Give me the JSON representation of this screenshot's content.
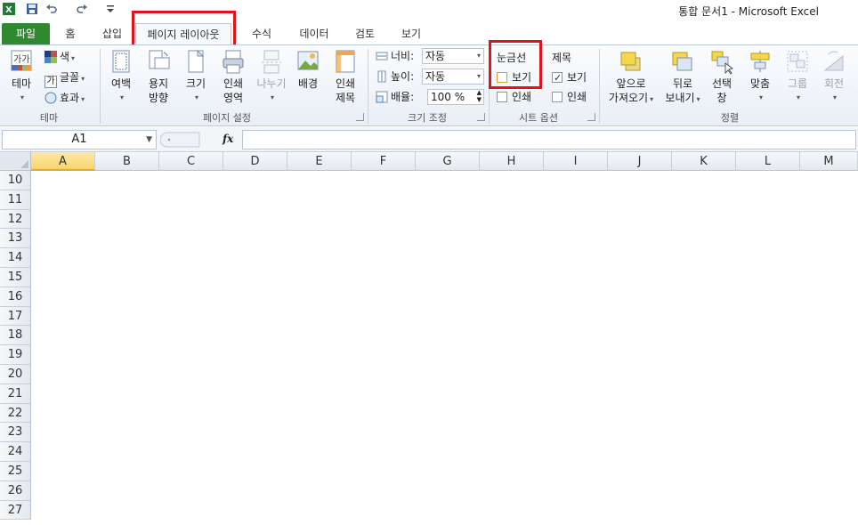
{
  "window": {
    "title": "통합 문서1  -  Microsoft Excel"
  },
  "tabs": [
    {
      "id": "file",
      "label": "파일"
    },
    {
      "id": "home",
      "label": "홈"
    },
    {
      "id": "insert",
      "label": "삽입"
    },
    {
      "id": "page_layout",
      "label": "페이지 레이아웃",
      "active": true
    },
    {
      "id": "formulas",
      "label": "수식"
    },
    {
      "id": "data",
      "label": "데이터"
    },
    {
      "id": "review",
      "label": "검토"
    },
    {
      "id": "view",
      "label": "보기"
    }
  ],
  "ribbon": {
    "theme": {
      "group_label": "테마",
      "theme_button": "테마",
      "theme_icon_text": "가가",
      "colors": "색",
      "fonts": "글꼴",
      "fonts_icon_text": "가",
      "effects": "효과"
    },
    "page_setup": {
      "group_label": "페이지 설정",
      "margins": "여백",
      "orientation": [
        "용지",
        "방향"
      ],
      "size": "크기",
      "print_area": [
        "인쇄",
        "영역"
      ],
      "breaks": "나누기",
      "background": "배경",
      "print_titles": [
        "인쇄",
        "제목"
      ]
    },
    "scale": {
      "group_label": "크기 조정",
      "width_label": "너비:",
      "width_value": "자동",
      "height_label": "높이:",
      "height_value": "자동",
      "scale_label": "배율:",
      "scale_value": "100 %"
    },
    "sheet_options": {
      "group_label": "시트 옵션",
      "gridlines_title": "눈금선",
      "gridlines_view": "보기",
      "gridlines_view_checked": false,
      "gridlines_print": "인쇄",
      "gridlines_print_checked": false,
      "headings_title": "제목",
      "headings_view": "보기",
      "headings_view_checked": true,
      "headings_print": "인쇄",
      "headings_print_checked": false
    },
    "arrange": {
      "group_label": "정렬",
      "bring_forward": [
        "앞으로",
        "가져오기"
      ],
      "send_backward": [
        "뒤로",
        "보내기"
      ],
      "selection_pane": [
        "선택",
        "창"
      ],
      "align": "맞춤",
      "group": "그룹",
      "rotate": "회전"
    }
  },
  "formula_bar": {
    "name_box": "A1",
    "fx_label": "fx",
    "formula": ""
  },
  "sheet": {
    "columns": [
      "A",
      "B",
      "C",
      "D",
      "E",
      "F",
      "G",
      "H",
      "I",
      "J",
      "K",
      "L",
      "M"
    ],
    "selected_column": "A",
    "rows": [
      "10",
      "11",
      "12",
      "13",
      "14",
      "15",
      "16",
      "17",
      "18",
      "19",
      "20",
      "21",
      "22",
      "23",
      "24",
      "25",
      "26",
      "27"
    ]
  },
  "colors": {
    "file_tab": "#2f8a2f",
    "highlight": "#e0141e",
    "selected_header": "#f8d56c"
  }
}
